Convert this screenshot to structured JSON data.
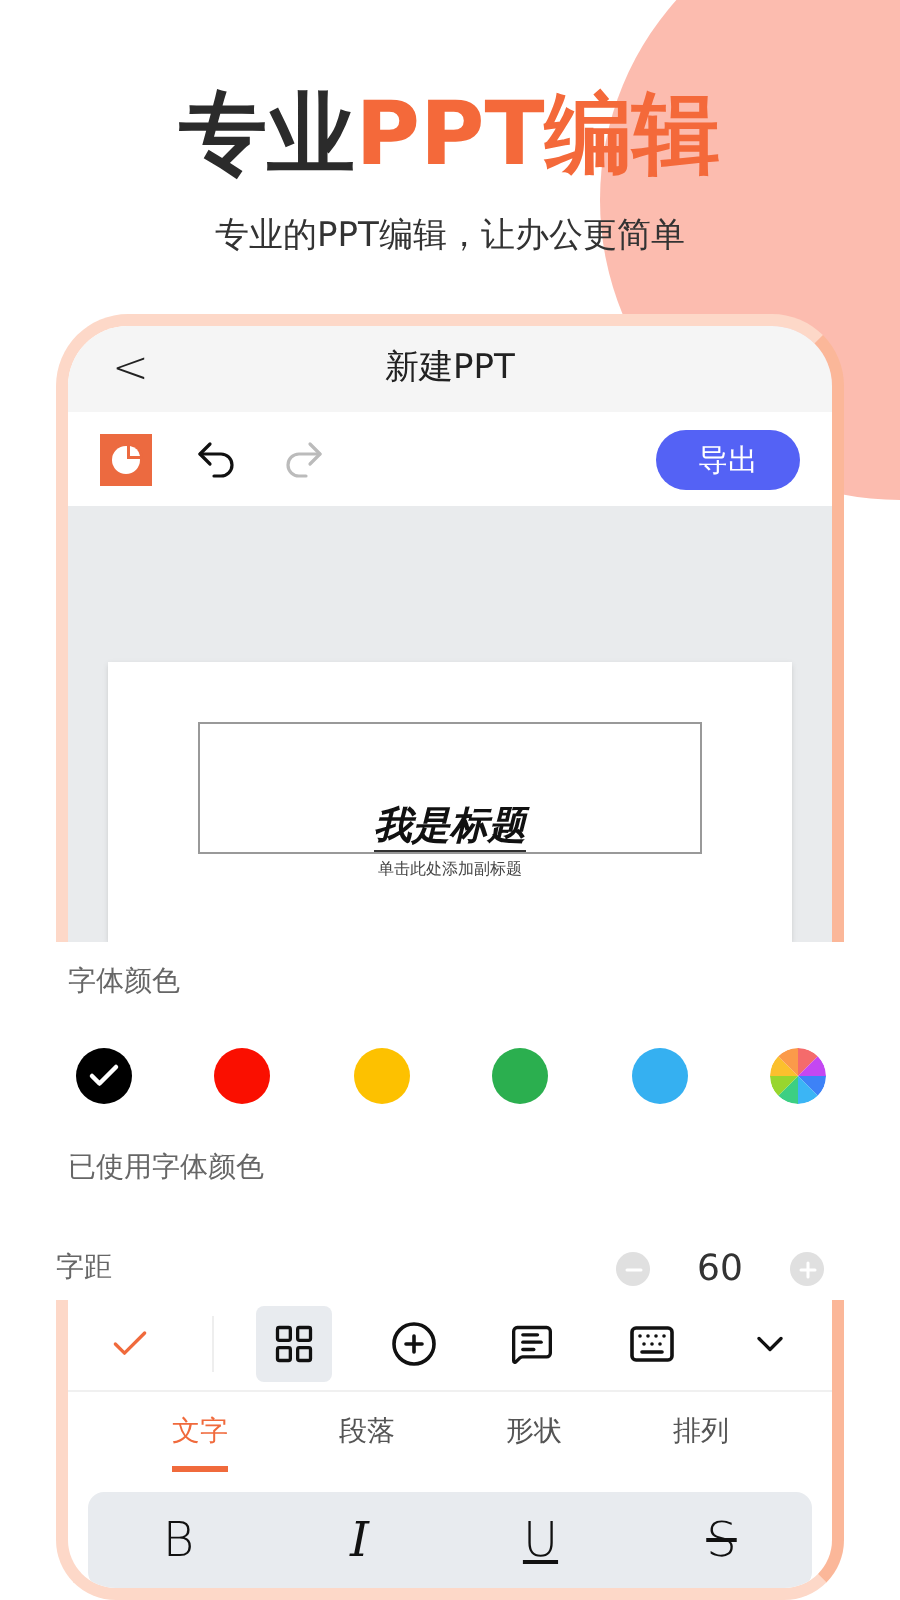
{
  "headline": {
    "lead": "专业",
    "accent": "PPT编辑"
  },
  "subtitle": "专业的PPT编辑，让办公更简单",
  "header": {
    "back": "<",
    "title": "新建PPT"
  },
  "toolbar": {
    "export": "导出"
  },
  "slide": {
    "title": "我是标题",
    "subtitle": "单击此处添加副标题"
  },
  "font_color": {
    "label": "字体颜色",
    "swatches": [
      {
        "kind": "solid",
        "color": "#000000",
        "selected": true
      },
      {
        "kind": "solid",
        "color": "#fa0f00",
        "selected": false
      },
      {
        "kind": "solid",
        "color": "#fdc100",
        "selected": false
      },
      {
        "kind": "solid",
        "color": "#2baf4f",
        "selected": false
      },
      {
        "kind": "solid",
        "color": "#35b0f1",
        "selected": false
      },
      {
        "kind": "wheel",
        "selected": false
      }
    ],
    "used_label": "已使用字体颜色"
  },
  "spacing": {
    "label": "字距",
    "value": "60"
  },
  "edit_tools": [
    {
      "kind": "check",
      "selected": false
    },
    {
      "kind": "grid",
      "selected": true
    },
    {
      "kind": "add",
      "selected": false
    },
    {
      "kind": "comment",
      "selected": false
    },
    {
      "kind": "keyboard",
      "selected": false
    },
    {
      "kind": "collapse",
      "selected": false
    }
  ],
  "tabs": [
    {
      "label": "文字",
      "selected": true
    },
    {
      "label": "段落",
      "selected": false
    },
    {
      "label": "形状",
      "selected": false
    },
    {
      "label": "排列",
      "selected": false
    }
  ],
  "format_buttons": [
    {
      "kind": "bold",
      "label": "B"
    },
    {
      "kind": "italic",
      "label": "I"
    },
    {
      "kind": "underline",
      "label": "U"
    },
    {
      "kind": "strike",
      "label": "S"
    }
  ]
}
